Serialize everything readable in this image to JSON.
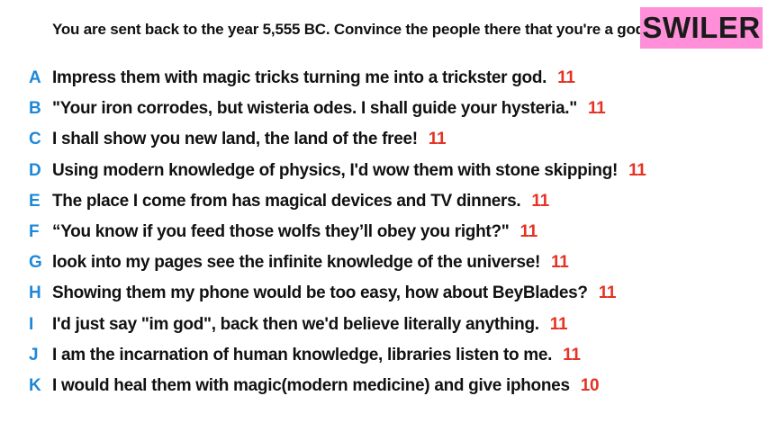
{
  "prompt": "You are sent back to the year 5,555 BC. Convince the people there that you're a god.",
  "brand": "SWILER",
  "colors": {
    "letter": "#1e88d8",
    "score": "#e53222",
    "badge": "#ff8fd8"
  },
  "answers": [
    {
      "letter": "A",
      "text": "Impress them with magic tricks turning me into a trickster god.",
      "score": "11"
    },
    {
      "letter": "B",
      "text": "\"Your iron corrodes, but wisteria odes. I shall guide your hysteria.\"",
      "score": "11"
    },
    {
      "letter": "C",
      "text": "I shall show you new land, the land of the free!",
      "score": "11"
    },
    {
      "letter": "D",
      "text": "Using modern knowledge of physics, I'd wow them with stone skipping!",
      "score": "11"
    },
    {
      "letter": "E",
      "text": "The place I come from has magical devices and TV dinners.",
      "score": "11"
    },
    {
      "letter": "F",
      "text": "“You know if you feed those wolfs they’ll obey you right?\"",
      "score": "11"
    },
    {
      "letter": "G",
      "text": "look into my pages see the infinite knowledge of the universe!",
      "score": "11"
    },
    {
      "letter": "H",
      "text": "Showing them my phone would be too easy, how about BeyBlades?",
      "score": "11"
    },
    {
      "letter": "I",
      "text": "I'd just say \"im god\", back then we'd believe literally anything.",
      "score": "11"
    },
    {
      "letter": "J",
      "text": "I am the incarnation of human knowledge, libraries listen to me.",
      "score": "11"
    },
    {
      "letter": "K",
      "text": "I would heal them with magic(modern medicine) and give iphones",
      "score": "10"
    }
  ]
}
